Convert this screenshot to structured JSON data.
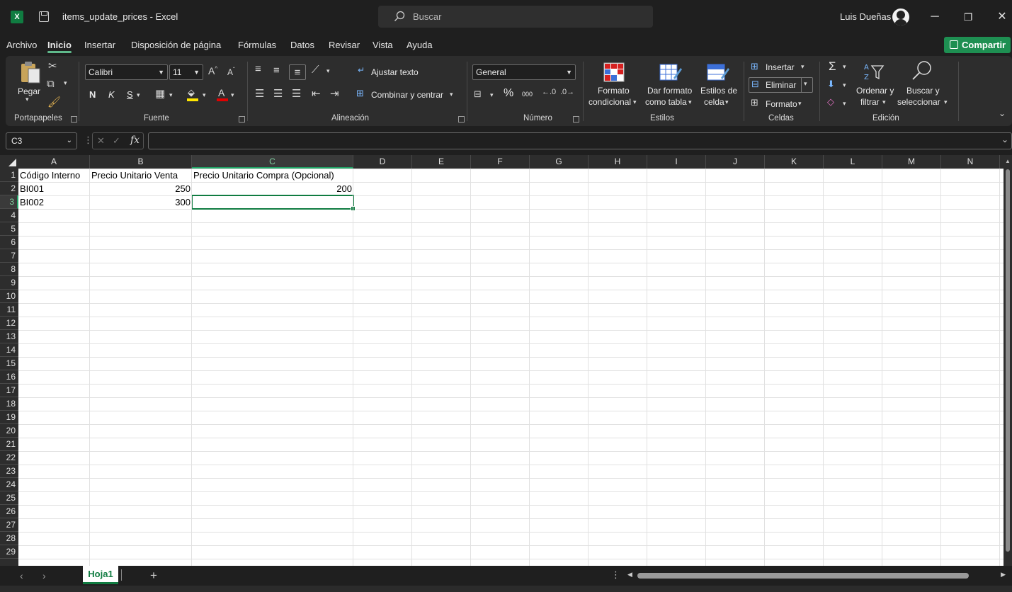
{
  "window": {
    "doc_title": "items_update_prices  -  Excel",
    "search_placeholder": "Buscar",
    "user_name": "Luis Dueñas",
    "minimize": "─",
    "restore": "❐",
    "close": "✕"
  },
  "menu": {
    "tabs": [
      "Archivo",
      "Inicio",
      "Insertar",
      "Disposición de página",
      "Fórmulas",
      "Datos",
      "Revisar",
      "Vista",
      "Ayuda"
    ],
    "active": "Inicio",
    "share_label": "Compartir"
  },
  "ribbon": {
    "clipboard": {
      "paste_label": "Pegar",
      "group_label": "Portapapeles"
    },
    "font": {
      "font_name": "Calibri",
      "font_size": "11",
      "bold": "N",
      "italic": "K",
      "underline": "S",
      "increase": "A^",
      "decrease": "Aˇ",
      "group_label": "Fuente",
      "font_color_letter": "A"
    },
    "alignment": {
      "wrap_text": "Ajustar texto",
      "merge_center": "Combinar y centrar",
      "group_label": "Alineación"
    },
    "number": {
      "format": "General",
      "percent": "%",
      "thousands": "000",
      "group_label": "Número"
    },
    "styles": {
      "conditional_line1": "Formato",
      "conditional_line2": "condicional",
      "table_line1": "Dar formato",
      "table_line2": "como tabla",
      "cell_styles_line1": "Estilos de",
      "cell_styles_line2": "celda",
      "group_label": "Estilos"
    },
    "cells": {
      "insert": "Insertar",
      "delete": "Eliminar",
      "format": "Formato",
      "group_label": "Celdas"
    },
    "editing": {
      "sum_symbol": "Σ",
      "sort_line1": "Ordenar y",
      "sort_line2": "filtrar",
      "find_line1": "Buscar y",
      "find_line2": "seleccionar",
      "group_label": "Edición"
    }
  },
  "formula_bar": {
    "name_box": "C3",
    "fx": "fx",
    "formula": ""
  },
  "sheet": {
    "columns": [
      "A",
      "B",
      "C",
      "D",
      "E",
      "F",
      "G",
      "H",
      "I",
      "J",
      "K",
      "L",
      "M",
      "N"
    ],
    "selected_column": "C",
    "selected_row": 3,
    "row_count": 29,
    "cells": {
      "A1": "Código Interno",
      "B1": "Precio Unitario Venta",
      "C1": "Precio Unitario Compra (Opcional)",
      "A2": "BI001",
      "B2": "250",
      "C2": "200",
      "A3": "BI002",
      "B3": "300"
    }
  },
  "sheet_tabs": {
    "tabs": [
      "Hoja1"
    ],
    "active": "Hoja1",
    "add": "+"
  },
  "colors": {
    "accent_green": "#107c41",
    "share_green": "#1e8f52",
    "background": "#1f1f1f",
    "ribbon": "#2d2d2d"
  }
}
